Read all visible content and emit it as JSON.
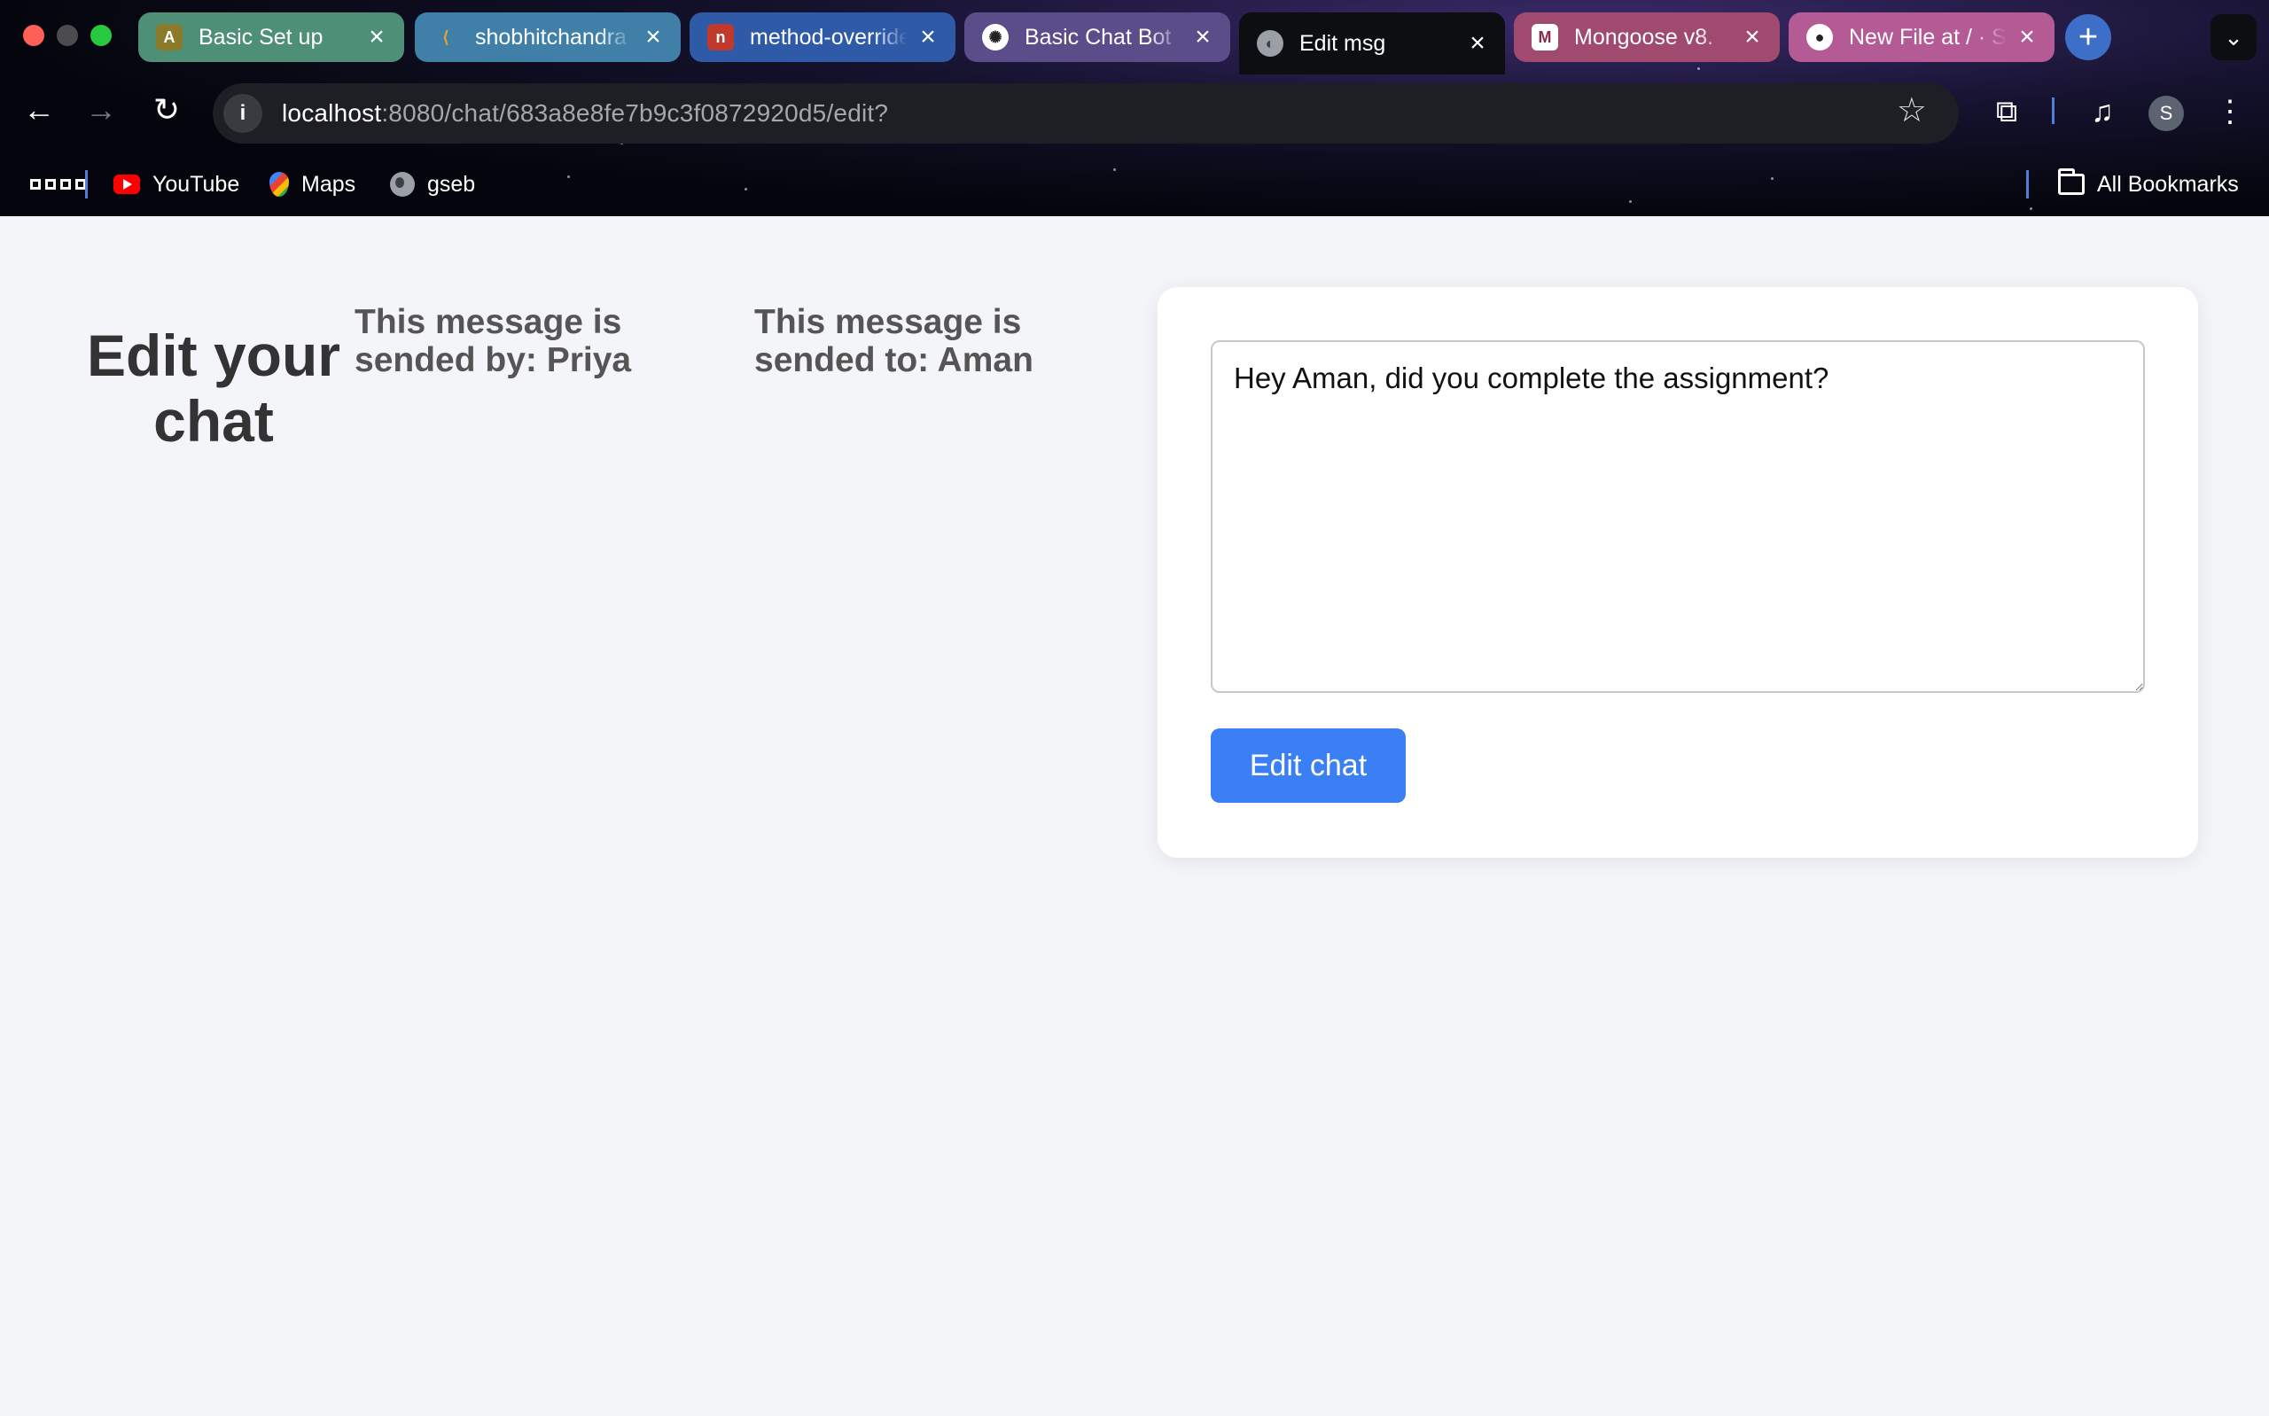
{
  "browser": {
    "tabs": [
      {
        "title": "Basic Set up",
        "active": false,
        "color": "#4e8f78",
        "icon": "site-favicon"
      },
      {
        "title": "shobhitchandra",
        "active": false,
        "color": "#3f7fa8",
        "icon": "leetcode-icon"
      },
      {
        "title": "method-override",
        "active": false,
        "color": "#2f5aa8",
        "icon": "npm-icon"
      },
      {
        "title": "Basic Chat Bot",
        "active": false,
        "color": "#5b4d8a",
        "icon": "openai-icon"
      },
      {
        "title": "Edit msg",
        "active": true,
        "color": "#0d0e12",
        "icon": "globe-icon"
      },
      {
        "title": "Mongoose v8.",
        "active": false,
        "color": "#a04a6f",
        "icon": "mongoose-icon"
      },
      {
        "title": "New File at / · S",
        "active": false,
        "color": "#b45a94",
        "icon": "github-icon"
      }
    ],
    "new_tab_glyph": "+",
    "tab_search_glyph": "⌄",
    "address": {
      "host": "localhost",
      "path": ":8080/chat/683a8e8fe7b9c3f0872920d5/edit?"
    },
    "profile_initial": "S",
    "bookmarks": {
      "items": [
        "YouTube",
        "Maps",
        "gseb"
      ],
      "all_label": "All Bookmarks"
    }
  },
  "page": {
    "heading": "Edit your chat",
    "sender_text": "This message is sended by: Priya",
    "receiver_text": "This message is sended to: Aman",
    "message_value": "Hey Aman, did you complete the assignment?",
    "submit_label": "Edit chat"
  },
  "colors": {
    "primary_button": "#3b7ff5",
    "page_background": "#f4f5f9"
  }
}
